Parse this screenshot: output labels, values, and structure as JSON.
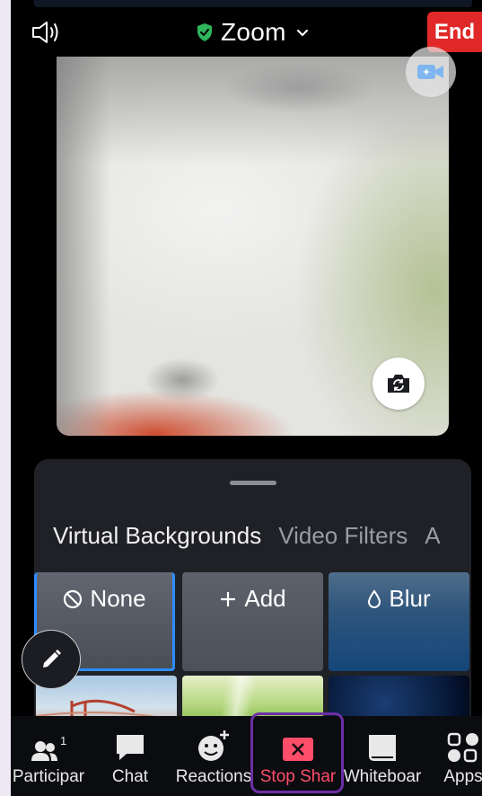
{
  "meeting": {
    "title": "Zoom",
    "end_label": "End"
  },
  "sheet": {
    "tabs": [
      "Virtual Backgrounds",
      "Video Filters",
      "A"
    ],
    "tiles": {
      "none": "None",
      "add": "Add",
      "blur": "Blur"
    }
  },
  "toolbar": {
    "participants_label": "Participar",
    "participants_count": "1",
    "chat_label": "Chat",
    "reactions_label": "Reactions",
    "stop_share_label": "Stop Shar",
    "whiteboard_label": "Whiteboar",
    "apps_label": "Apps"
  },
  "colors": {
    "end_button": "#e02828",
    "shield": "#2fb55b",
    "selected_tile_border": "#2d8cff",
    "stop_share": "#ff4d6a",
    "highlight_frame": "#6c2fa6"
  },
  "icons": {
    "audio": "speaker-icon",
    "shield": "shield-check-icon",
    "dropdown": "chevron-down-icon",
    "camera_effect": "camera-effect-icon",
    "flip_camera": "flip-camera-icon",
    "none": "block-icon",
    "add": "plus-icon",
    "blur": "droplet-icon",
    "edit": "pencil-icon",
    "participants": "participants-icon",
    "chat": "chat-bubble-icon",
    "reactions": "add-reaction-icon",
    "stop_share": "stop-share-icon",
    "whiteboard": "whiteboard-icon",
    "apps": "apps-icon"
  }
}
